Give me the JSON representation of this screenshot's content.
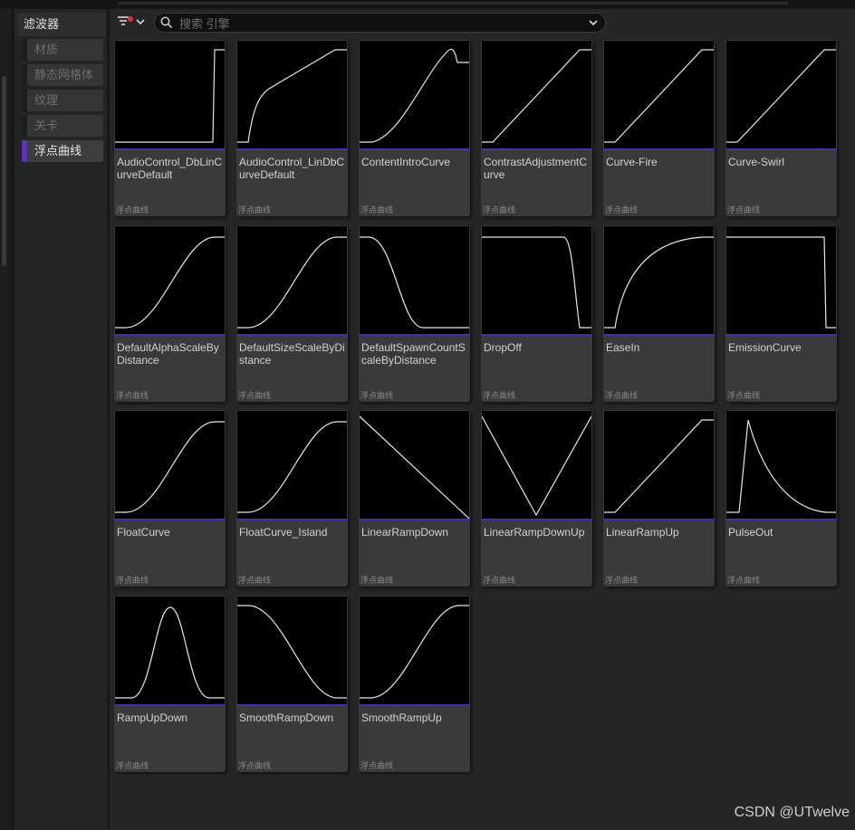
{
  "filters": {
    "header": "滤波器",
    "items": [
      {
        "label": "材质",
        "active": false
      },
      {
        "label": "静态网格体",
        "active": false
      },
      {
        "label": "纹理",
        "active": false
      },
      {
        "label": "关卡",
        "active": false
      },
      {
        "label": "浮点曲线",
        "active": true
      }
    ]
  },
  "search": {
    "placeholder": "搜索 引擎",
    "value": ""
  },
  "assets": [
    {
      "name": "AudioControl_DbLinCurveDefault",
      "type": "浮点曲线",
      "curve": "step-up-right"
    },
    {
      "name": "AudioControl_LinDbCurveDefault",
      "type": "浮点曲线",
      "curve": "log-rise"
    },
    {
      "name": "ContentIntroCurve",
      "type": "浮点曲线",
      "curve": "intro"
    },
    {
      "name": "ContrastAdjustmentCurve",
      "type": "浮点曲线",
      "curve": "ramp-plateaus"
    },
    {
      "name": "Curve-Fire",
      "type": "浮点曲线",
      "curve": "ramp-plateaus"
    },
    {
      "name": "Curve-Swirl",
      "type": "浮点曲线",
      "curve": "ramp-plateaus"
    },
    {
      "name": "DefaultAlphaScaleByDistance",
      "type": "浮点曲线",
      "curve": "s-rise"
    },
    {
      "name": "DefaultSizeScaleByDistance",
      "type": "浮点曲线",
      "curve": "s-rise"
    },
    {
      "name": "DefaultSpawnCountScaleByDistance",
      "type": "浮点曲线",
      "curve": "s-fall"
    },
    {
      "name": "DropOff",
      "type": "浮点曲线",
      "curve": "dropoff"
    },
    {
      "name": "EaseIn",
      "type": "浮点曲线",
      "curve": "ease"
    },
    {
      "name": "EmissionCurve",
      "type": "浮点曲线",
      "curve": "emission"
    },
    {
      "name": "FloatCurve",
      "type": "浮点曲线",
      "curve": "s-rise"
    },
    {
      "name": "FloatCurve_Island",
      "type": "浮点曲线",
      "curve": "s-rise"
    },
    {
      "name": "LinearRampDown",
      "type": "浮点曲线",
      "curve": "linear-down"
    },
    {
      "name": "LinearRampDownUp",
      "type": "浮点曲线",
      "curve": "v-shape"
    },
    {
      "name": "LinearRampUp",
      "type": "浮点曲线",
      "curve": "linear-up"
    },
    {
      "name": "PulseOut",
      "type": "浮点曲线",
      "curve": "pulse"
    },
    {
      "name": "RampUpDown",
      "type": "浮点曲线",
      "curve": "bell"
    },
    {
      "name": "SmoothRampDown",
      "type": "浮点曲线",
      "curve": "smooth-down"
    },
    {
      "name": "SmoothRampUp",
      "type": "浮点曲线",
      "curve": "smooth-up"
    }
  ],
  "watermark": "CSDN @UTwelve",
  "colors": {
    "accent": "#5b2fc9",
    "tile_accent": "#4a2ea8",
    "curve": "#e6e6e6",
    "notify": "#e03030"
  }
}
